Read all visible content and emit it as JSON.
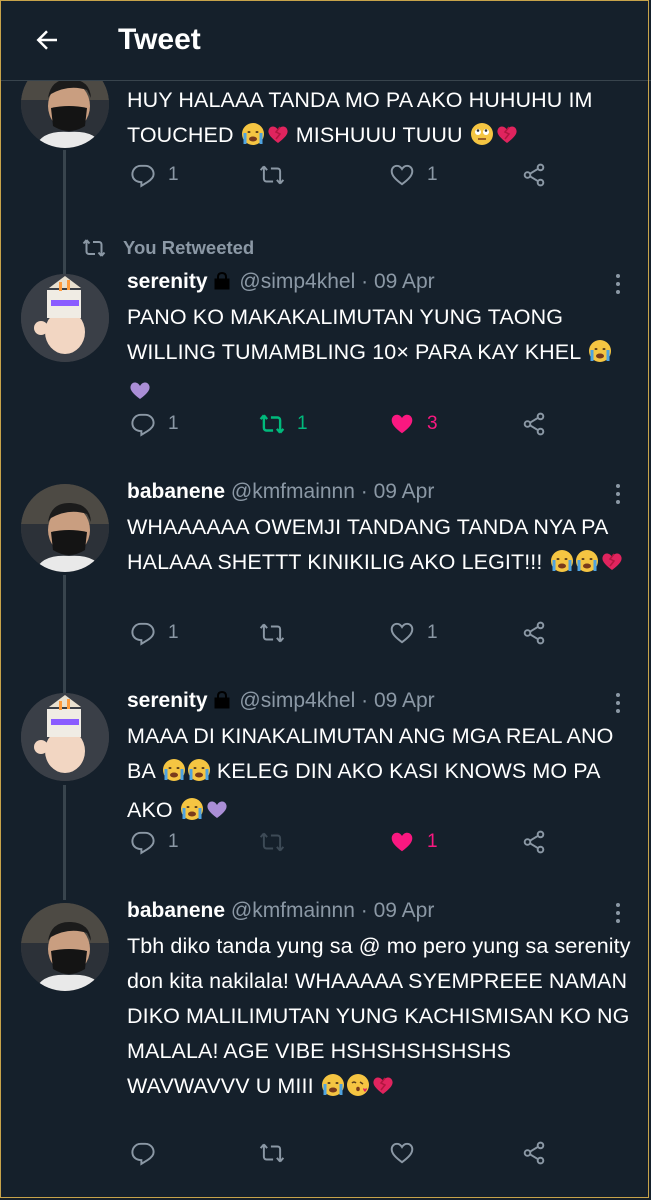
{
  "header": {
    "title": "Tweet"
  },
  "retweet_note": "You Retweeted",
  "tweets": [
    {
      "name": "",
      "handle": "",
      "date": "",
      "text": "HUY HALAAA TANDA MO PA AKO HUHUHU IM TOUCHED",
      "text_tail": "MISHUUU TUUU",
      "reply_count": "1",
      "retweet_count": "",
      "like_count": "1"
    },
    {
      "name": "serenity",
      "handle": "@simp4khel",
      "date": "09 Apr",
      "text": "PANO KO MAKAKALIMUTAN YUNG TAONG WILLING TUMAMBLING 10× PARA KAY KHEL",
      "reply_count": "1",
      "retweet_count": "1",
      "like_count": "3"
    },
    {
      "name": "babanene",
      "handle": "@kmfmainnn",
      "date": "09 Apr",
      "text": "WHAAAAAA OWEMJI TANDANG TANDA NYA PA HALAAA SHETTT KINIKILIG AKO LEGIT!!!",
      "reply_count": "1",
      "retweet_count": "",
      "like_count": "1"
    },
    {
      "name": "serenity",
      "handle": "@simp4khel",
      "date": "09 Apr",
      "text": "MAAA DI KINAKALIMUTAN ANG MGA REAL ANO BA",
      "text_mid": "KELEG DIN AKO KASI KNOWS MO PA AKO",
      "reply_count": "1",
      "retweet_count": "",
      "like_count": "1"
    },
    {
      "name": "babanene",
      "handle": "@kmfmainnn",
      "date": "09 Apr",
      "text": "Tbh diko tanda yung sa @ mo pero yung sa serenity don kita nakilala! WHAAAAA SYEMPREEE NAMAN DIKO MALILIMUTAN YUNG KACHISMISAN KO NG MALALA! AGE VIBE HSHSHSHSHSHS WAVWAVVV U MIII",
      "reply_count": "",
      "retweet_count": "",
      "like_count": ""
    }
  ],
  "icons": {
    "back": "arrow-left-icon",
    "reply": "reply-icon",
    "retweet": "retweet-icon",
    "like": "heart-icon",
    "share": "share-icon",
    "more": "more-icon",
    "lock": "lock-icon"
  },
  "colors": {
    "background": "#15202b",
    "muted": "#8b98a5",
    "retweet_active": "#00ba7c",
    "like_active": "#f91880",
    "divider": "#38444d"
  }
}
